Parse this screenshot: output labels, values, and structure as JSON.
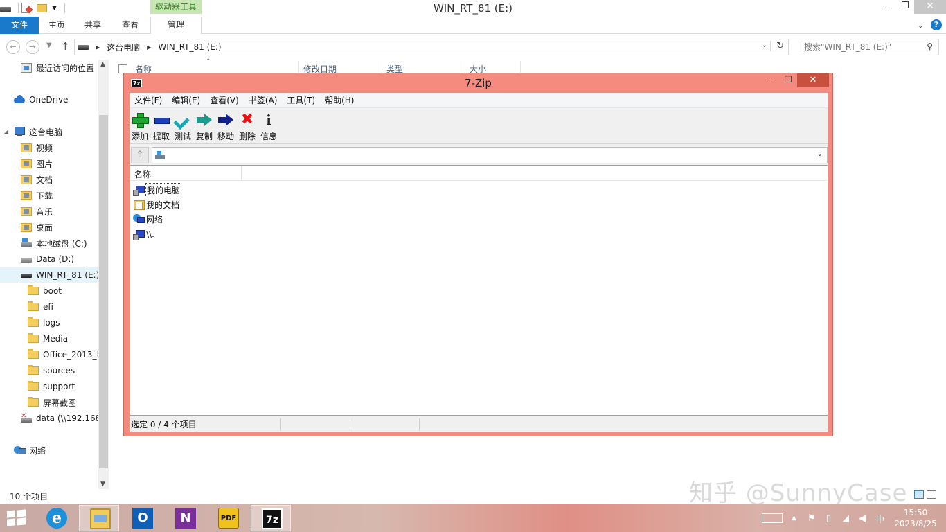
{
  "explorer": {
    "window_title": "WIN_RT_81 (E:)",
    "context_tab_header": "驱动器工具",
    "ribbon_tabs": {
      "file": "文件",
      "home": "主页",
      "share": "共享",
      "view": "查看",
      "manage": "管理"
    },
    "address": {
      "segments": [
        "这台电脑",
        "WIN_RT_81 (E:)"
      ]
    },
    "search": {
      "placeholder": "搜索\"WIN_RT_81 (E:)\""
    },
    "columns": {
      "name": "名称",
      "modified": "修改日期",
      "type": "类型",
      "size": "大小"
    },
    "nav": {
      "recent": "最近访问的位置",
      "onedrive": "OneDrive",
      "this_pc": "这台电脑",
      "videos": "视频",
      "pictures": "图片",
      "documents": "文档",
      "downloads": "下载",
      "music": "音乐",
      "desktop": "桌面",
      "local_c": "本地磁盘 (C:)",
      "data_d": "Data (D:)",
      "win_rt_e": "WIN_RT_81 (E:)",
      "boot": "boot",
      "efi": "efi",
      "logs": "logs",
      "media": "Media",
      "office": "Office_2013_R",
      "sources": "sources",
      "support": "support",
      "screenshots": "屏幕截图",
      "net_drive": "data (\\\\192.168",
      "network": "网络"
    },
    "status": "10 个项目"
  },
  "sevenzip": {
    "title": "7-Zip",
    "icon_label": "7z",
    "menu": [
      "文件(F)",
      "编辑(E)",
      "查看(V)",
      "书签(A)",
      "工具(T)",
      "帮助(H)"
    ],
    "toolbar": {
      "add": "添加",
      "extract": "提取",
      "test": "测试",
      "copy": "复制",
      "move": "移动",
      "delete": "删除",
      "info": "信息"
    },
    "path_value": "",
    "list_header": "名称",
    "items": [
      {
        "name": "我的电脑",
        "icon": "my-computer-icon"
      },
      {
        "name": "我的文档",
        "icon": "my-documents-icon"
      },
      {
        "name": "网络",
        "icon": "network-icon"
      },
      {
        "name": "\\\\.",
        "icon": "unc-computer-icon"
      }
    ],
    "status": {
      "selected": "选定 0 / 4 个项目",
      "p2": "",
      "p3": "",
      "p4": ""
    }
  },
  "watermark": "知乎 @SunnyCase",
  "taskbar": {
    "apps": [
      "Internet Explorer",
      "File Explorer",
      "Outlook",
      "OneNote",
      "PDF",
      "7-Zip"
    ],
    "ie_glyph": "e",
    "outlook_glyph": "O",
    "onenote_glyph": "N",
    "pdf_glyph": "PDF",
    "sevenzip_glyph": "7z",
    "ime": "中",
    "time": "15:50",
    "date": "2023/8/25"
  },
  "colors": {
    "file_tab": "#1979ca",
    "context_tab": "#c8e6b4",
    "sevenzip_frame": "#f48b7e",
    "close_red": "#c8503f"
  }
}
